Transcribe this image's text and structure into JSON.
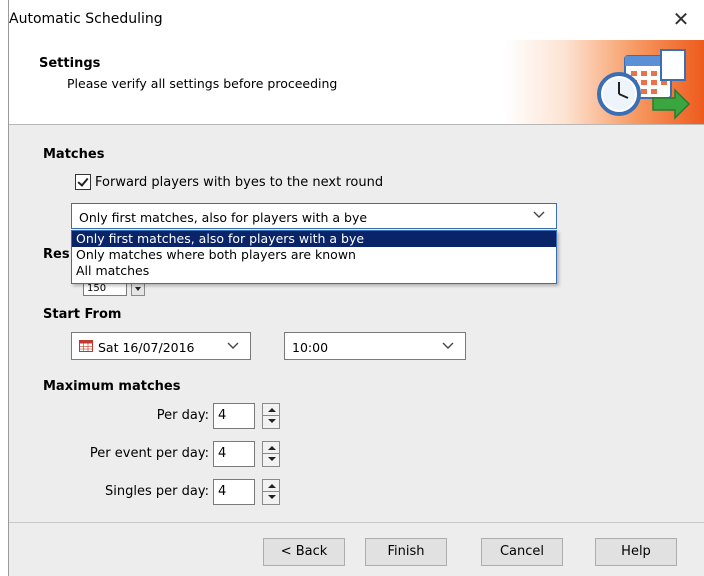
{
  "window": {
    "title": "Automatic Scheduling"
  },
  "header": {
    "title": "Settings",
    "subtitle": "Please verify all settings before proceeding"
  },
  "matches": {
    "section_label": "Matches",
    "forward_byes": {
      "label": "Forward players with byes to the next round",
      "checked": true
    },
    "mode_select": {
      "value": "Only first matches, also for players with a bye",
      "options": [
        "Only first matches, also for players with a bye",
        "Only matches where both players are known",
        "All matches"
      ],
      "selected_index": 0
    }
  },
  "rest": {
    "label_partial": "Res",
    "value_partial": "150"
  },
  "start_from": {
    "section_label": "Start From",
    "date": "Sat 16/07/2016",
    "time": "10:00"
  },
  "maximum_matches": {
    "section_label": "Maximum matches",
    "per_day": {
      "label": "Per day:",
      "value": "4"
    },
    "per_event_per_day": {
      "label": "Per event per day:",
      "value": "4"
    },
    "singles_per_day": {
      "label": "Singles per day:",
      "value": "4"
    }
  },
  "buttons": {
    "back": "< Back",
    "finish": "Finish",
    "cancel": "Cancel",
    "help": "Help"
  },
  "icons": {
    "close": "close-icon",
    "header": "schedule-calendar-clock-icon",
    "calendar": "calendar-icon",
    "chevron": "chevron-down-icon"
  },
  "colors": {
    "dropdown_selection": "#0a246a",
    "header_accent": "#ee5a1c"
  }
}
